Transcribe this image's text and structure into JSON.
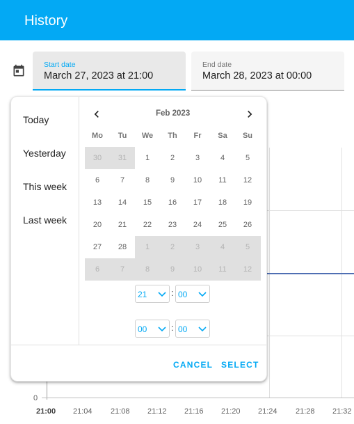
{
  "header": {
    "title": "History"
  },
  "start_date": {
    "label": "Start date",
    "value": "March 27, 2023 at 21:00"
  },
  "end_date": {
    "label": "End date",
    "value": "March 28, 2023 at 00:00"
  },
  "ranges": [
    "Today",
    "Yesterday",
    "This week",
    "Last week"
  ],
  "calendar": {
    "month_label": "Feb 2023",
    "weekdays": [
      "Mo",
      "Tu",
      "We",
      "Th",
      "Fr",
      "Sa",
      "Su"
    ],
    "weeks": [
      [
        "30",
        "31",
        "1",
        "2",
        "3",
        "4",
        "5"
      ],
      [
        "6",
        "7",
        "8",
        "9",
        "10",
        "11",
        "12"
      ],
      [
        "13",
        "14",
        "15",
        "16",
        "17",
        "18",
        "19"
      ],
      [
        "20",
        "21",
        "22",
        "23",
        "24",
        "25",
        "26"
      ],
      [
        "27",
        "28",
        "1",
        "2",
        "3",
        "4",
        "5"
      ],
      [
        "6",
        "7",
        "8",
        "9",
        "10",
        "11",
        "12"
      ]
    ]
  },
  "start_time": {
    "hour": "21",
    "minute": "00",
    "separator": ":"
  },
  "end_time": {
    "hour": "00",
    "minute": "00",
    "separator": ":"
  },
  "actions": {
    "cancel": "CANCEL",
    "select": "SELECT"
  },
  "chart": {
    "y_tick": "0",
    "x_ticks": [
      "21:00",
      "21:04",
      "21:08",
      "21:12",
      "21:16",
      "21:20",
      "21:24",
      "21:28",
      "21:32"
    ]
  },
  "colors": {
    "accent": "#03a9f4",
    "series": "#4f6fb3"
  },
  "icons": [
    "calendar-icon",
    "chevron-left-icon",
    "chevron-right-icon",
    "chevron-down-icon"
  ]
}
